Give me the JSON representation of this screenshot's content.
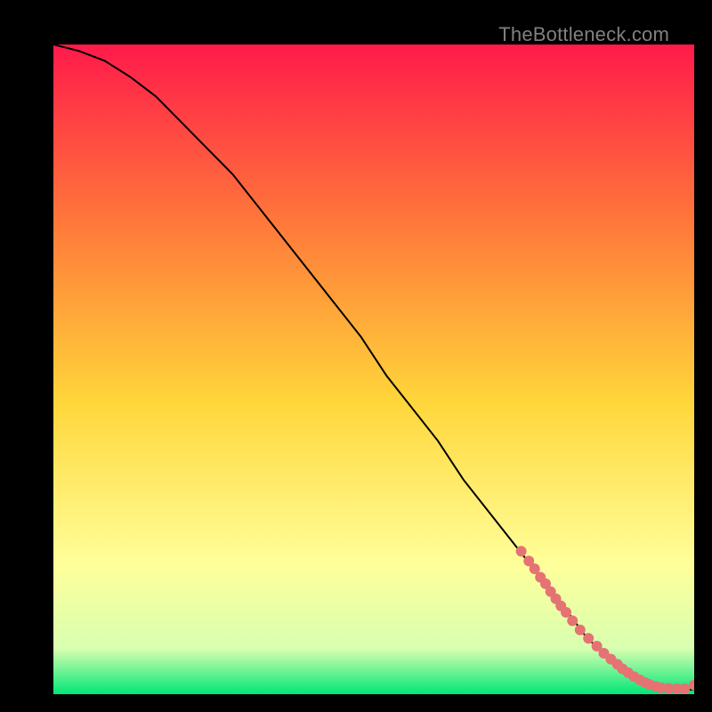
{
  "watermark": "TheBottleneck.com",
  "colors": {
    "gradient_top": "#ff1a4a",
    "gradient_mid1": "#ff7a3a",
    "gradient_mid2": "#ffd63a",
    "gradient_mid3": "#ffff9a",
    "gradient_mid4": "#d8ffb0",
    "gradient_bottom": "#00e676",
    "curve": "#000000",
    "points": "#e57373",
    "bg": "#000000"
  },
  "chart_data": {
    "type": "line",
    "title": "",
    "xlabel": "",
    "ylabel": "",
    "xlim": [
      0,
      100
    ],
    "ylim": [
      0,
      100
    ],
    "series": [
      {
        "name": "curve",
        "x": [
          0,
          4,
          8,
          12,
          16,
          20,
          24,
          28,
          32,
          36,
          40,
          44,
          48,
          52,
          56,
          60,
          64,
          68,
          72,
          76,
          80,
          83,
          86,
          88,
          90,
          92,
          94,
          96,
          98,
          100
        ],
        "y": [
          100,
          99,
          97.5,
          95,
          92,
          88,
          84,
          80,
          75,
          70,
          65,
          60,
          55,
          49,
          44,
          39,
          33,
          28,
          23,
          18,
          13,
          9,
          6,
          4,
          2.5,
          1.6,
          1.0,
          0.8,
          0.7,
          0.7
        ]
      }
    ],
    "scatter": {
      "name": "points",
      "x": [
        73,
        74.2,
        75.1,
        76.0,
        76.8,
        77.6,
        78.4,
        79.2,
        80.0,
        81.0,
        82.2,
        83.5,
        84.8,
        85.9,
        87.0,
        88.0,
        88.8,
        89.7,
        90.6,
        91.5,
        92.3,
        93.0,
        94.0,
        94.8,
        96.0,
        97.3,
        98.5,
        100.0
      ],
      "y": [
        22.0,
        20.5,
        19.3,
        18.0,
        17.0,
        15.8,
        14.7,
        13.6,
        12.6,
        11.3,
        9.9,
        8.6,
        7.4,
        6.3,
        5.4,
        4.6,
        3.9,
        3.3,
        2.7,
        2.2,
        1.8,
        1.5,
        1.2,
        1.0,
        0.9,
        0.85,
        0.85,
        1.4
      ]
    }
  }
}
